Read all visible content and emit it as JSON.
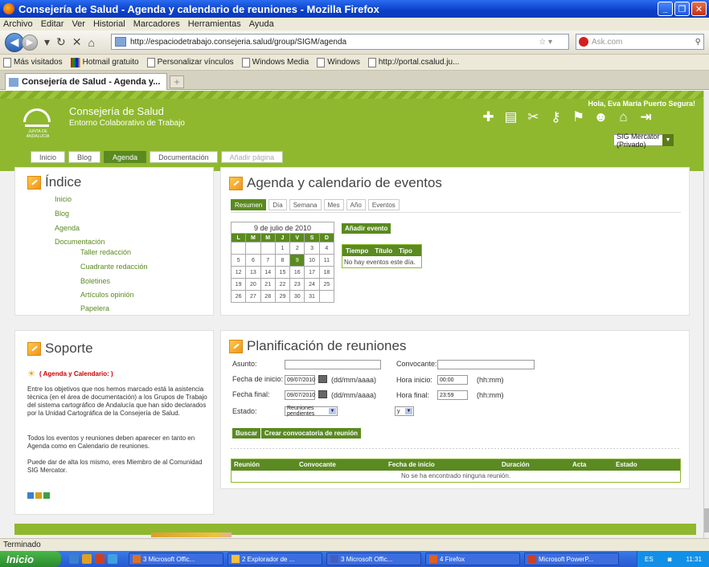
{
  "window": {
    "title": "Consejería de Salud - Agenda y calendario de reuniones - Mozilla Firefox"
  },
  "menu": [
    "Archivo",
    "Editar",
    "Ver",
    "Historial",
    "Marcadores",
    "Herramientas",
    "Ayuda"
  ],
  "browser": {
    "url": "http://espaciodetrabajo.consejeria.salud/group/SIGM/agenda",
    "search_placeholder": "Ask.com"
  },
  "bookmarks": [
    "Más visitados",
    "Hotmail gratuito",
    "Personalizar vínculos",
    "Windows Media",
    "Windows",
    "http://portal.csalud.ju..."
  ],
  "tab": {
    "title": "Consejería de Salud - Agenda y..."
  },
  "site": {
    "logo_text": "JUNTA DE ANDALUCIA",
    "title": "Consejería de Salud",
    "subtitle": "Entorno Colaborativo de Trabajo",
    "greeting": "Hola, Eva María Puerto Segura!",
    "group_select": "SIG Mercator (Privado)",
    "nav_tabs": [
      "Inicio",
      "Blog",
      "Agenda",
      "Documentación",
      "Añadir página"
    ]
  },
  "indice": {
    "title": "Índice",
    "items": [
      "Inicio",
      "Blog",
      "Agenda",
      "Documentación"
    ],
    "subitems": [
      "Taller redacción",
      "Cuadrante redacción",
      "Boletines",
      "Artículos opinión",
      "Papelera"
    ]
  },
  "soporte": {
    "title": "Soporte",
    "highlight": "( Agenda y Calendario: )",
    "p1": "Entre los objetivos que nos hemos marcado está la asistencia técnica (en el área de documentación) a los Grupos de Trabajo del sistema cartográfico de Andalucía que han sido declarados por la Unidad Cartográfica de la Consejería de Salud.",
    "p2": "Todos los eventos y reuniones deben aparecer en tanto en Agenda como en Calendario de reuniones.",
    "p3": "Puede dar de alta los mismo, eres Miembro de al Comunidad SIG Mercator."
  },
  "agenda": {
    "title": "Agenda y calendario de eventos",
    "tabs": [
      "Resumen",
      "Día",
      "Semana",
      "Mes",
      "Año",
      "Eventos"
    ],
    "calendar_title": "9 de julio de 2010",
    "weekdays": [
      "L",
      "M",
      "M",
      "J",
      "V",
      "S",
      "D"
    ],
    "weeks": [
      [
        "",
        "",
        "",
        "1",
        "2",
        "3",
        "4"
      ],
      [
        "5",
        "6",
        "7",
        "8",
        "9",
        "10",
        "11"
      ],
      [
        "12",
        "13",
        "14",
        "15",
        "16",
        "17",
        "18"
      ],
      [
        "19",
        "20",
        "21",
        "22",
        "23",
        "24",
        "25"
      ],
      [
        "26",
        "27",
        "28",
        "29",
        "30",
        "31",
        ""
      ]
    ],
    "today": "9",
    "add_event": "Añadir evento",
    "events_headers": [
      "Tiempo",
      "Título",
      "Tipo"
    ],
    "events_empty": "No hay eventos este día."
  },
  "planificacion": {
    "title": "Planificación de reuniones",
    "asunto_label": "Asunto:",
    "convocante_label": "Convocante:",
    "fecha_inicio_label": "Fecha de inicio:",
    "fecha_inicio": "09/07/2010",
    "date_hint": "(dd/mm/aaaa)",
    "hora_inicio_label": "Hora inicio:",
    "hora_inicio": "00:00",
    "time_hint": "(hh:mm)",
    "fecha_final_label": "Fecha final:",
    "fecha_final": "09/07/2010",
    "hora_final_label": "Hora final:",
    "hora_final": "23:59",
    "estado_label": "Estado:",
    "estado_value": "Reuniones pendientes",
    "op_value": "y",
    "buscar": "Buscar",
    "crear": "Crear convocatoria de reunión",
    "table_headers": [
      "Reunión",
      "Convocante",
      "Fecha de inicio",
      "Duración",
      "Acta",
      "Estado"
    ],
    "table_empty": "No se ha encontrado ninguna reunión."
  },
  "status": "Terminado",
  "taskbar": {
    "start": "Inicio",
    "tasks": [
      "3 Microsoft Offic...",
      "2 Explorador de ...",
      "3 Microsoft Offic...",
      "4 Firefox",
      "Microsoft PowerP..."
    ],
    "lang": "ES",
    "clock": "11:31"
  }
}
